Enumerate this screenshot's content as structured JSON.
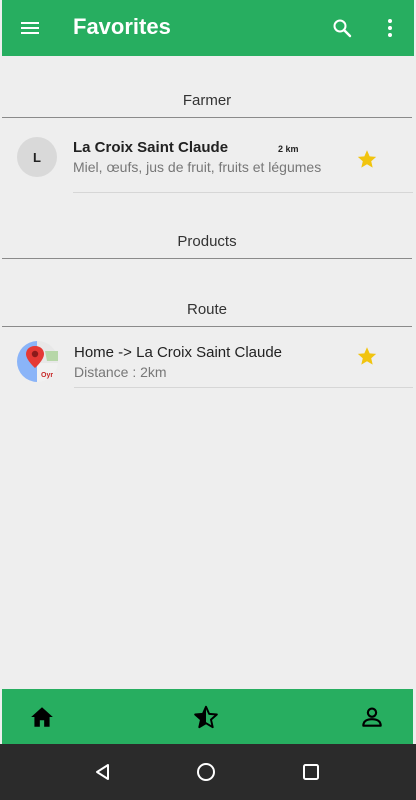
{
  "appbar": {
    "title": "Favorites",
    "icons": {
      "menu": "menu-icon",
      "search": "search-icon",
      "more": "more-vert-icon"
    },
    "color": "#27ae60"
  },
  "sections": {
    "farmer": {
      "header": "Farmer",
      "item": {
        "avatar_letter": "L",
        "name": "La Croix Saint Claude",
        "distance": "2 km",
        "description": "Miel, œufs, jus de fruit, fruits et légumes",
        "favorite_icon": "star-icon"
      }
    },
    "products": {
      "header": "Products"
    },
    "route": {
      "header": "Route",
      "item": {
        "icon": "map-icon",
        "title": "Home -> La Croix Saint Claude",
        "distance": "Distance : 2km",
        "favorite_icon": "star-icon"
      }
    }
  },
  "bottom_nav": {
    "items": [
      {
        "icon": "home-icon"
      },
      {
        "icon": "star-half-icon"
      },
      {
        "icon": "person-icon"
      }
    ]
  },
  "system_nav": {
    "items": [
      {
        "icon": "back-icon"
      },
      {
        "icon": "home-circle-icon"
      },
      {
        "icon": "recents-icon"
      }
    ]
  },
  "colors": {
    "accent": "#27ae60",
    "star": "#f1c40f",
    "background": "#eeeeee"
  }
}
